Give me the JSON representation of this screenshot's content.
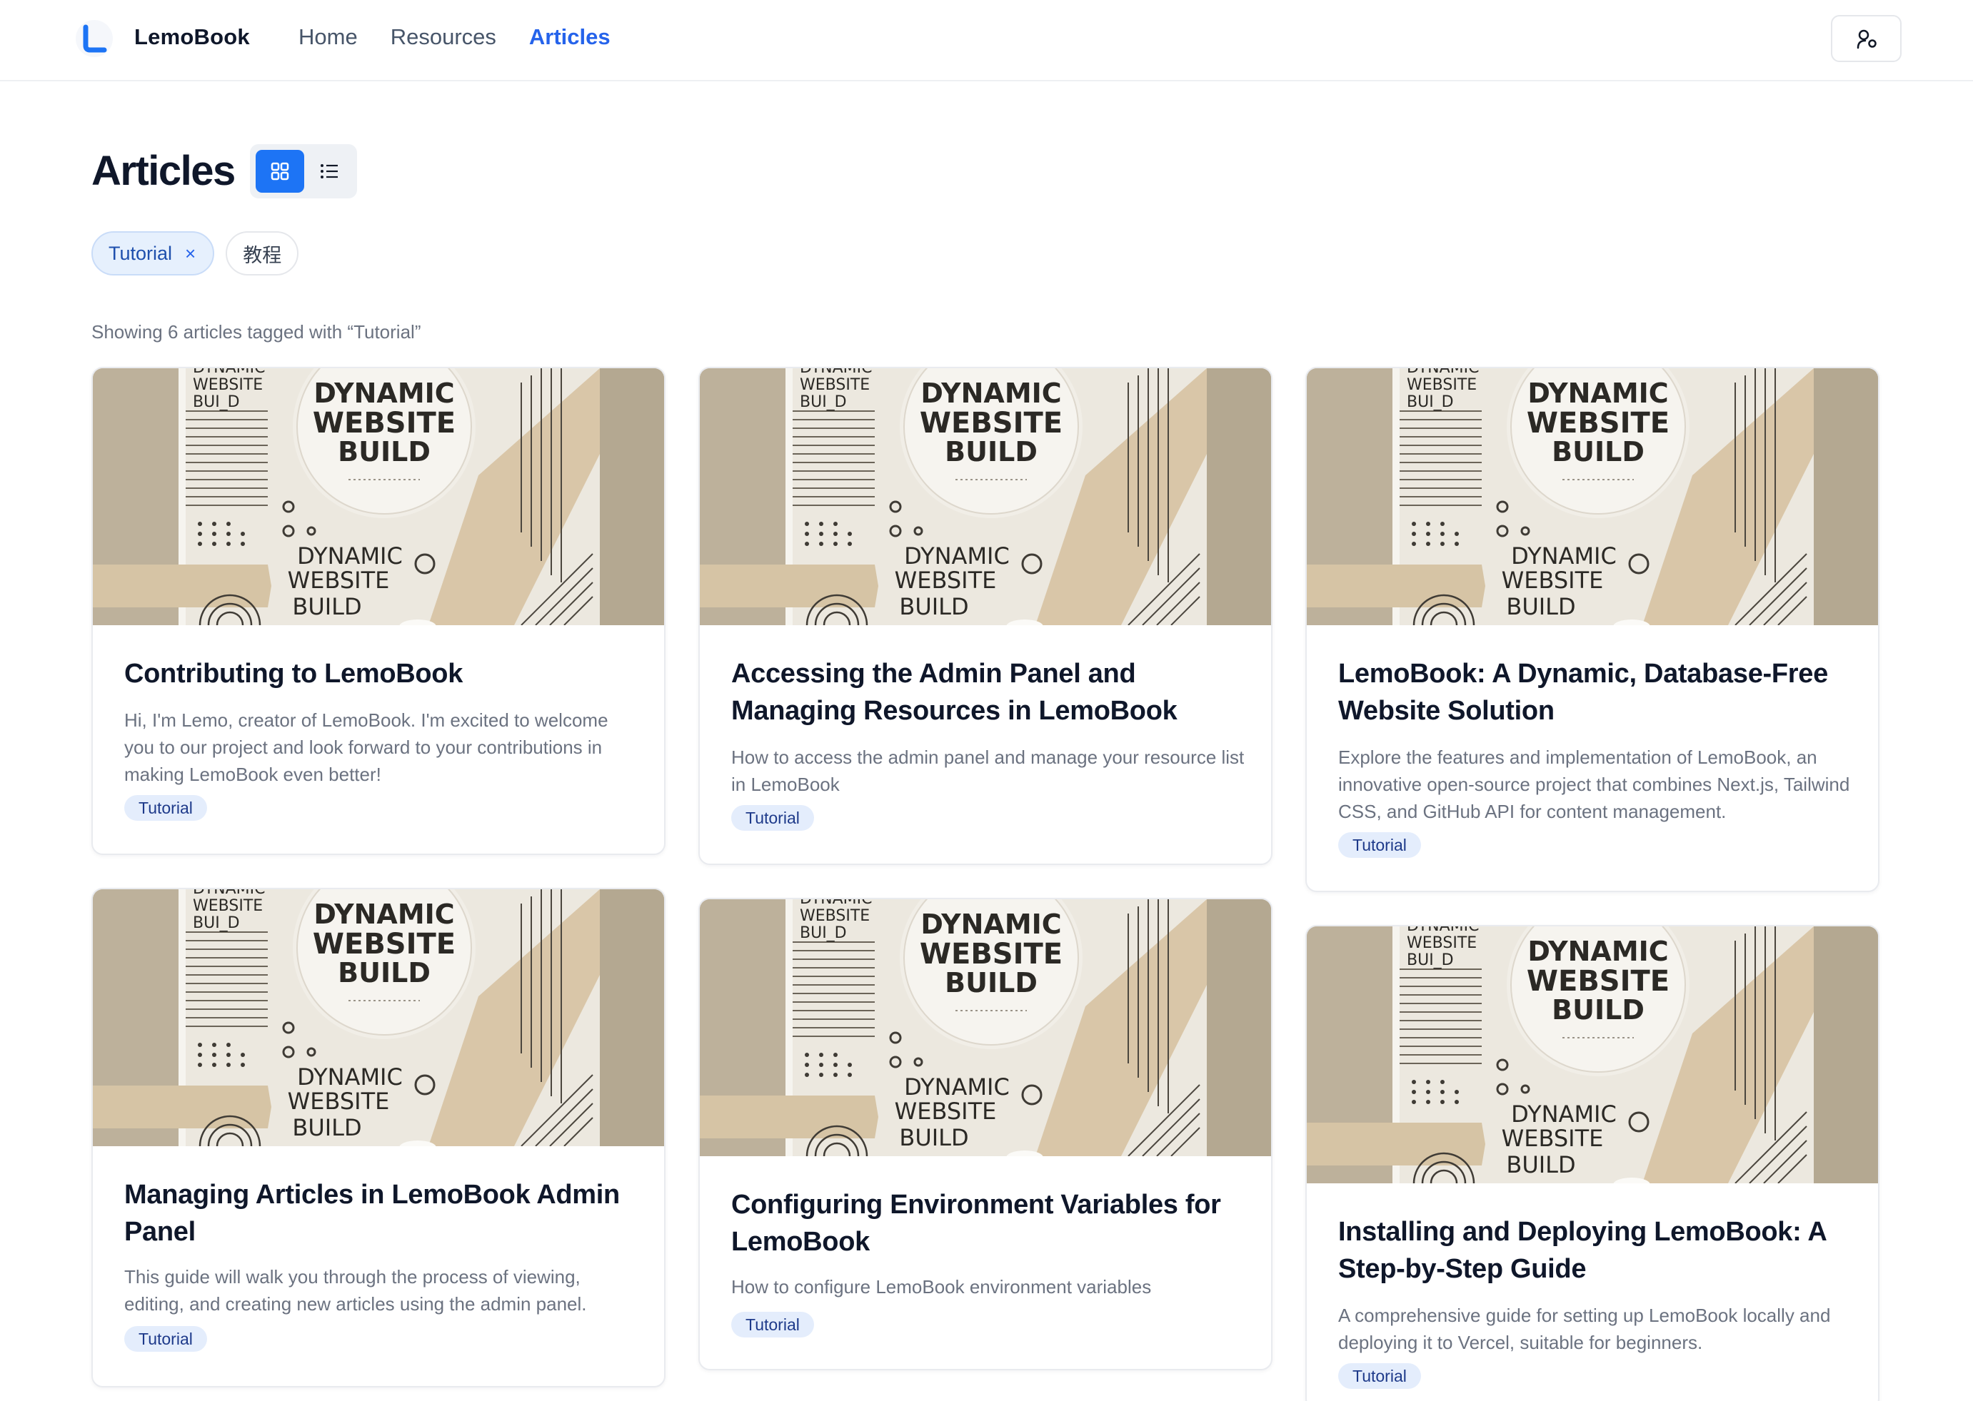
{
  "header": {
    "brand": "LemoBook",
    "nav": [
      "Home",
      "Resources",
      "Articles"
    ],
    "active_nav": "Articles",
    "accent_color": "#2563eb"
  },
  "page": {
    "title": "Articles",
    "view_modes": [
      "grid-icon",
      "list-icon"
    ],
    "active_view": "grid"
  },
  "tags": {
    "active": {
      "label": "Tutorial",
      "remove": "×"
    },
    "other": "教程"
  },
  "showing_text": "Showing 6 articles tagged with “Tutorial”",
  "cover_image": {
    "text_large": [
      "DYNAMIC",
      "WEBSITE",
      "BUILD"
    ],
    "text_top": [
      "DYNAMIC",
      "WEBSITE",
      "BUI_D"
    ]
  },
  "articles": [
    {
      "title": "Contributing to LemoBook",
      "excerpt": "Hi, I'm Lemo, creator of LemoBook. I'm excited to welcome you to our project and look forward to your contributions in making LemoBook even better!",
      "tag": "Tutorial"
    },
    {
      "title": "Accessing the Admin Panel and Managing Resources in LemoBook",
      "excerpt": "How to access the admin panel and manage your resource list in LemoBook",
      "tag": "Tutorial"
    },
    {
      "title": "LemoBook: A Dynamic, Database-Free Website Solution",
      "excerpt": "Explore the features and implementation of LemoBook, an innovative open-source project that combines Next.js, Tailwind CSS, and GitHub API for content management.",
      "tag": "Tutorial"
    },
    {
      "title": "Managing Articles in LemoBook Admin Panel",
      "excerpt": "This guide will walk you through the process of viewing, editing, and creating new articles using the admin panel.",
      "tag": "Tutorial"
    },
    {
      "title": "Configuring Environment Variables for LemoBook",
      "excerpt": "How to configure LemoBook environment variables",
      "tag": "Tutorial"
    },
    {
      "title": "Installing and Deploying LemoBook: A Step-by-Step Guide",
      "excerpt": "A comprehensive guide for setting up LemoBook locally and deploying it to Vercel, suitable for beginners.",
      "tag": "Tutorial"
    }
  ]
}
